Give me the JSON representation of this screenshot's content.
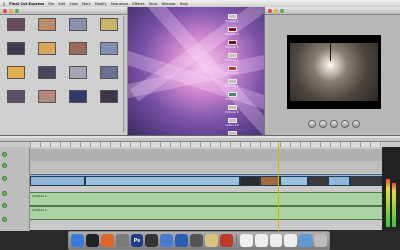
{
  "menubar": {
    "apple": "",
    "app_name": "Final Cut Express",
    "items": [
      "File",
      "Edit",
      "View",
      "Mark",
      "Modify",
      "Sequence",
      "Effects",
      "Tools",
      "Window",
      "Help"
    ]
  },
  "browser": {
    "clips": [
      {
        "label": "",
        "color": "#6b4a5e"
      },
      {
        "label": "",
        "color": "#b98c6d"
      },
      {
        "label": "",
        "color": "#8a8fb0"
      },
      {
        "label": "",
        "color": "#c9b26f"
      },
      {
        "label": "",
        "color": "#3f3a52"
      },
      {
        "label": "",
        "color": "#d8a55a"
      },
      {
        "label": "",
        "color": "#9a6b5d"
      },
      {
        "label": "",
        "color": "#7d8fb4"
      },
      {
        "label": "",
        "color": "#e0b04a"
      },
      {
        "label": "",
        "color": "#4b4560"
      },
      {
        "label": "",
        "color": "#a8a2b6"
      },
      {
        "label": "",
        "color": "#6b6f8f"
      },
      {
        "label": "",
        "color": "#5a4e6a"
      },
      {
        "label": "",
        "color": "#b38a7a"
      },
      {
        "label": "",
        "color": "#2f3c6a"
      },
      {
        "label": "",
        "color": "#3e3348"
      }
    ]
  },
  "effects": {
    "items": [
      {
        "label": "Picture 1",
        "color": "#c6c0c0"
      },
      {
        "label": "Picture 2",
        "color": "#7a1020"
      },
      {
        "label": "Picture 3",
        "color": "#7a1020"
      },
      {
        "label": "Picture 4",
        "color": "#c0c0c0"
      },
      {
        "label": "Picture 5",
        "color": "#aa4040"
      },
      {
        "label": "Picture 6",
        "color": "#c0c0c0"
      },
      {
        "label": "Picture 7",
        "color": "#4a8a6a"
      },
      {
        "label": "Picture 8",
        "color": "#c0c0c0"
      },
      {
        "label": "Video 10",
        "color": "#c0c0c0"
      },
      {
        "label": "Video 11",
        "color": "#c0c0c0"
      }
    ]
  },
  "timeline": {
    "audio_clip_1": "Untitled 1",
    "audio_clip_2": "Untitled 1"
  },
  "dock": {
    "items": [
      {
        "name": "finder",
        "color": "#3a7bd5",
        "glyph": ""
      },
      {
        "name": "dashboard",
        "color": "#222",
        "glyph": ""
      },
      {
        "name": "firefox",
        "color": "#e0662a",
        "glyph": ""
      },
      {
        "name": "system-preferences",
        "color": "#7a7a7a",
        "glyph": ""
      },
      {
        "name": "photoshop",
        "color": "#1f3f8a",
        "glyph": "Ps"
      },
      {
        "name": "final-cut",
        "color": "#333",
        "glyph": ""
      },
      {
        "name": "itunes",
        "color": "#4a7ad0",
        "glyph": ""
      },
      {
        "name": "quicktime",
        "color": "#2d5db0",
        "glyph": ""
      },
      {
        "name": "chess",
        "color": "#555",
        "glyph": ""
      },
      {
        "name": "preview",
        "color": "#d9c27a",
        "glyph": ""
      },
      {
        "name": "app-red",
        "color": "#c0392b",
        "glyph": ""
      },
      {
        "name": "doc-1",
        "color": "#eee",
        "glyph": ""
      },
      {
        "name": "doc-2",
        "color": "#eee",
        "glyph": ""
      },
      {
        "name": "doc-3",
        "color": "#eee",
        "glyph": ""
      },
      {
        "name": "doc-4",
        "color": "#eee",
        "glyph": ""
      },
      {
        "name": "downloads",
        "color": "#5a9bd5",
        "glyph": ""
      },
      {
        "name": "trash",
        "color": "#bbb",
        "glyph": ""
      }
    ]
  }
}
